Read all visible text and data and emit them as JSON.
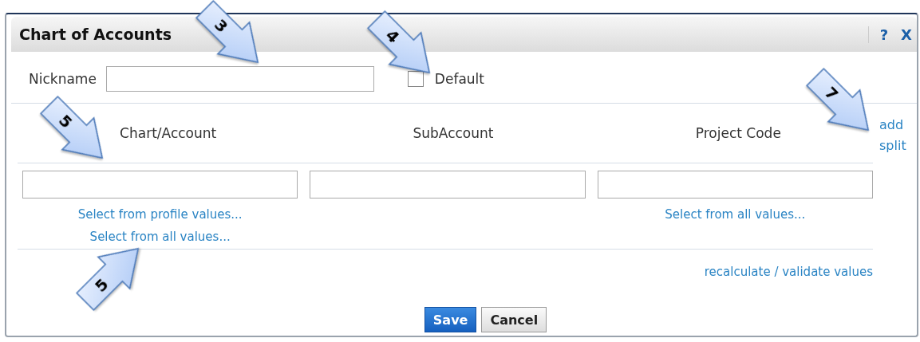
{
  "window": {
    "title": "Chart of Accounts",
    "help": "?",
    "close": "X"
  },
  "nickname": {
    "label": "Nickname"
  },
  "default_checkbox": {
    "label": "Default",
    "checked": false
  },
  "columns": [
    {
      "heading": "Chart/Account",
      "links": [
        "Select from profile values...",
        "Select from all values..."
      ]
    },
    {
      "heading": "SubAccount"
    },
    {
      "heading": "Project Code",
      "links": [
        "Select from all values..."
      ]
    }
  ],
  "add_split": "add split",
  "recalculate": "recalculate / validate values",
  "buttons": [
    {
      "label": "Save",
      "kind": "primary"
    },
    {
      "label": "Cancel",
      "kind": "secondary"
    }
  ],
  "callouts": [
    {
      "label": "3",
      "kind": "downward"
    },
    {
      "label": "4",
      "kind": "downward"
    },
    {
      "label": "7",
      "kind": "downward"
    },
    {
      "label": "5",
      "kind": "downward"
    },
    {
      "label": "5",
      "kind": "upward"
    }
  ]
}
